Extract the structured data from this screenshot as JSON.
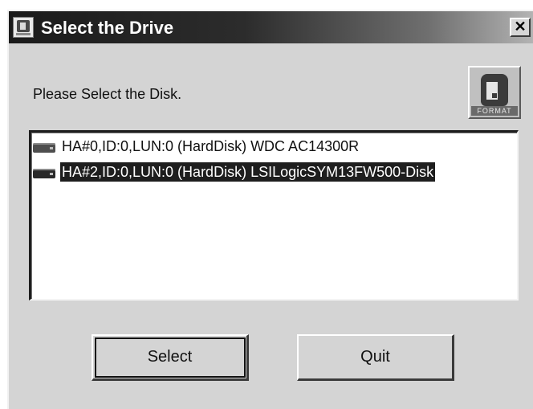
{
  "window": {
    "title": "Select the Drive",
    "close_glyph": "✕"
  },
  "prompt": "Please Select the Disk.",
  "logo": {
    "icon": "format-disk-icon",
    "text": "FORMAT"
  },
  "disks": [
    {
      "label": "HA#0,ID:0,LUN:0 (HardDisk) WDC AC14300R",
      "selected": false,
      "icon": "hard-disk-icon"
    },
    {
      "label": "HA#2,ID:0,LUN:0 (HardDisk) LSILogicSYM13FW500-Disk",
      "selected": true,
      "icon": "hard-disk-icon"
    }
  ],
  "buttons": {
    "select_label": "Select",
    "quit_label": "Quit"
  },
  "colors": {
    "selection_bg": "#1e1e1e",
    "window_bg": "#d4d4d4"
  }
}
